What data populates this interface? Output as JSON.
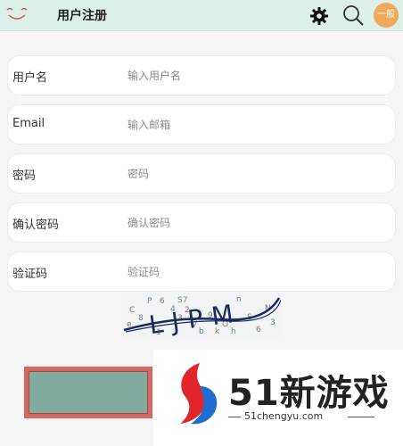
{
  "header": {
    "title": "用户注册",
    "avatar_label": "一般",
    "accent": "#dcf0e7"
  },
  "form": {
    "fields": [
      {
        "label": "用户名",
        "placeholder": "输入用户名"
      },
      {
        "label": "Email",
        "placeholder": "输入邮箱"
      },
      {
        "label": "密码",
        "placeholder": "密码"
      },
      {
        "label": "确认密码",
        "placeholder": "确认密码"
      },
      {
        "label": "验证码",
        "placeholder": "验证码"
      }
    ]
  },
  "captcha": {
    "text": "LJPM",
    "noise": [
      "P",
      "6",
      "S7",
      "C",
      "4",
      "2",
      "e",
      "8",
      "3",
      "9",
      "O",
      "n",
      "S",
      "6",
      "b",
      "k",
      "h",
      "N",
      "1",
      "3",
      "V"
    ]
  },
  "submit": {
    "color": "#7eab9d",
    "border": "#d46763"
  },
  "watermark": {
    "brand": "51新游戏",
    "url": "51chengyu.com"
  }
}
